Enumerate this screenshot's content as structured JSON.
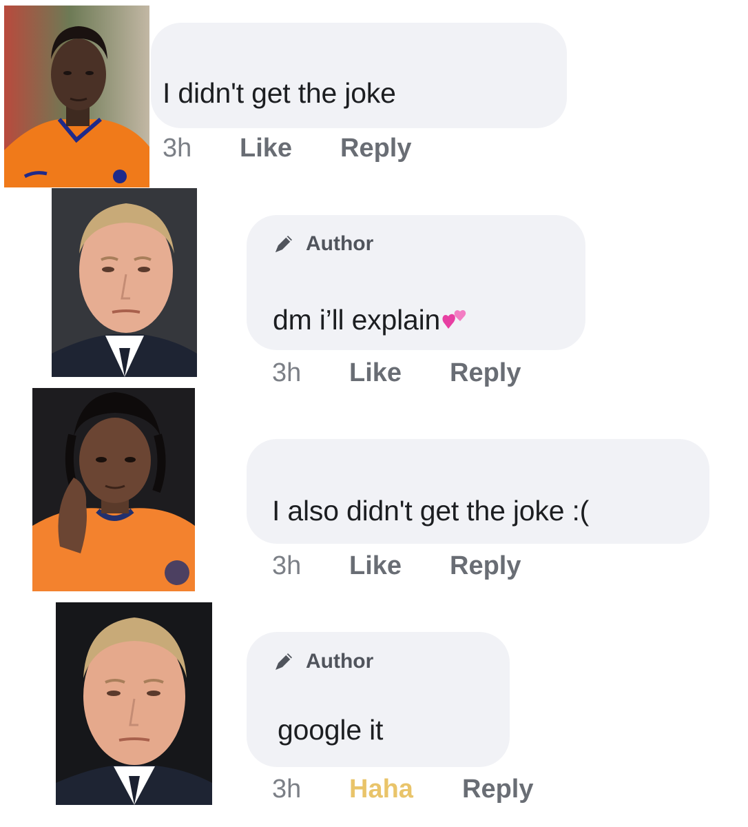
{
  "comments": [
    {
      "text": "I didn't get the joke",
      "is_author": false,
      "time": "3h",
      "like": "Like",
      "reply": "Reply"
    },
    {
      "author_label": "Author",
      "text": "dm i’ll explain",
      "emoji": "two-hearts",
      "is_author": true,
      "time": "3h",
      "like": "Like",
      "reply": "Reply"
    },
    {
      "text": "I also didn't get the joke :(",
      "is_author": false,
      "time": "3h",
      "like": "Like",
      "reply": "Reply"
    },
    {
      "author_label": "Author",
      "text": "google it",
      "is_author": true,
      "time": "3h",
      "like": "Haha",
      "like_active": true,
      "reply": "Reply"
    }
  ],
  "colors": {
    "bubble": "#f1f2f6",
    "text": "#1c1e21",
    "action": "#696d74",
    "haha_active": "#e9c46a"
  }
}
